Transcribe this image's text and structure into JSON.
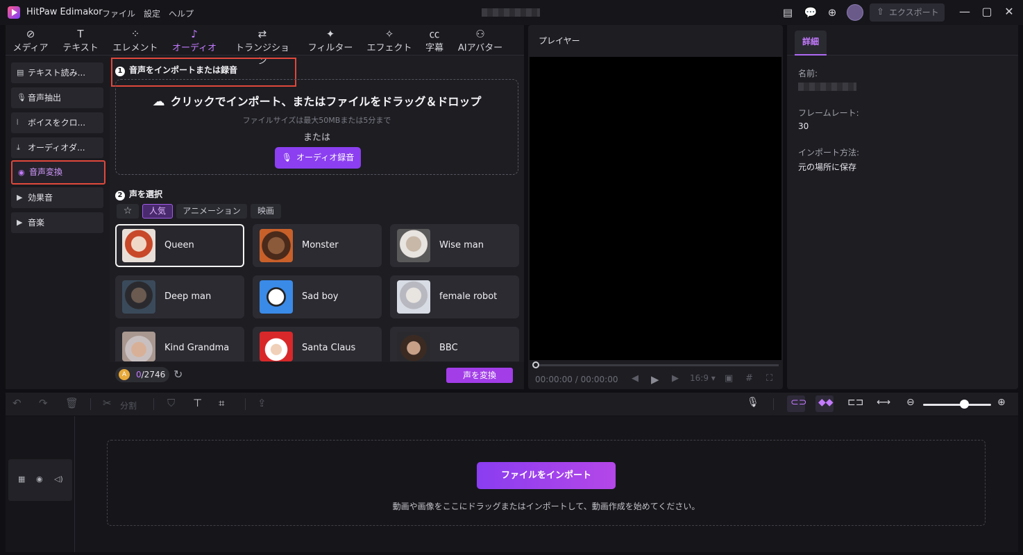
{
  "app": {
    "name": "HitPaw Edimakor",
    "menus": [
      "ファイル",
      "設定",
      "ヘルプ"
    ],
    "export_label": "エクスポート"
  },
  "tabs": [
    "メディア",
    "テキスト",
    "エレメント",
    "オーディオ",
    "トランジション",
    "フィルター",
    "エフェクト",
    "字幕",
    "AIアバター"
  ],
  "categories": [
    "テキスト読み...",
    "音声抽出",
    "ボイスをクロ...",
    "オーディオダ...",
    "音声変換",
    "効果音",
    "音楽"
  ],
  "import": {
    "step": "1",
    "section_title": "音声をインポートまたは録音",
    "title": "クリックでインポート、またはファイルをドラッグ＆ドロップ",
    "size_hint": "ファイルサイズは最大50MBまたは5分まで",
    "or": "または",
    "record_label": "オーディオ録音"
  },
  "voices": {
    "step": "2",
    "section_title": "声を選択",
    "filters": [
      "人気",
      "アニメーション",
      "映画"
    ],
    "active_filter": "人気",
    "items": [
      "Queen",
      "Monster",
      "Wise man",
      "Deep man",
      "Sad boy",
      "female robot",
      "Kind Grandma",
      "Santa Claus",
      "BBC"
    ],
    "selected": "Queen"
  },
  "credits": {
    "used": "0",
    "total": "/2746"
  },
  "convert_label": "声を変換",
  "player": {
    "title": "プレイヤー",
    "time": "00:00:00",
    "duration": "/ 00:00:00",
    "ratio": "16:9"
  },
  "details": {
    "tab": "詳細",
    "name_label": "名前:",
    "framerate_label": "フレームレート:",
    "framerate_value": "30",
    "import_label": "インポート方法:",
    "import_value": "元の場所に保存"
  },
  "timeline": {
    "split_label": "分割",
    "import_button": "ファイルをインポート",
    "hint": "動画や画像をここにドラッグまたはインポートして、動画作成を始めてください。",
    "zoom_level": 0.6
  },
  "colors": {
    "accent": "#a23de8",
    "active_text": "#c47bff",
    "highlight_box": "#e0483b"
  }
}
